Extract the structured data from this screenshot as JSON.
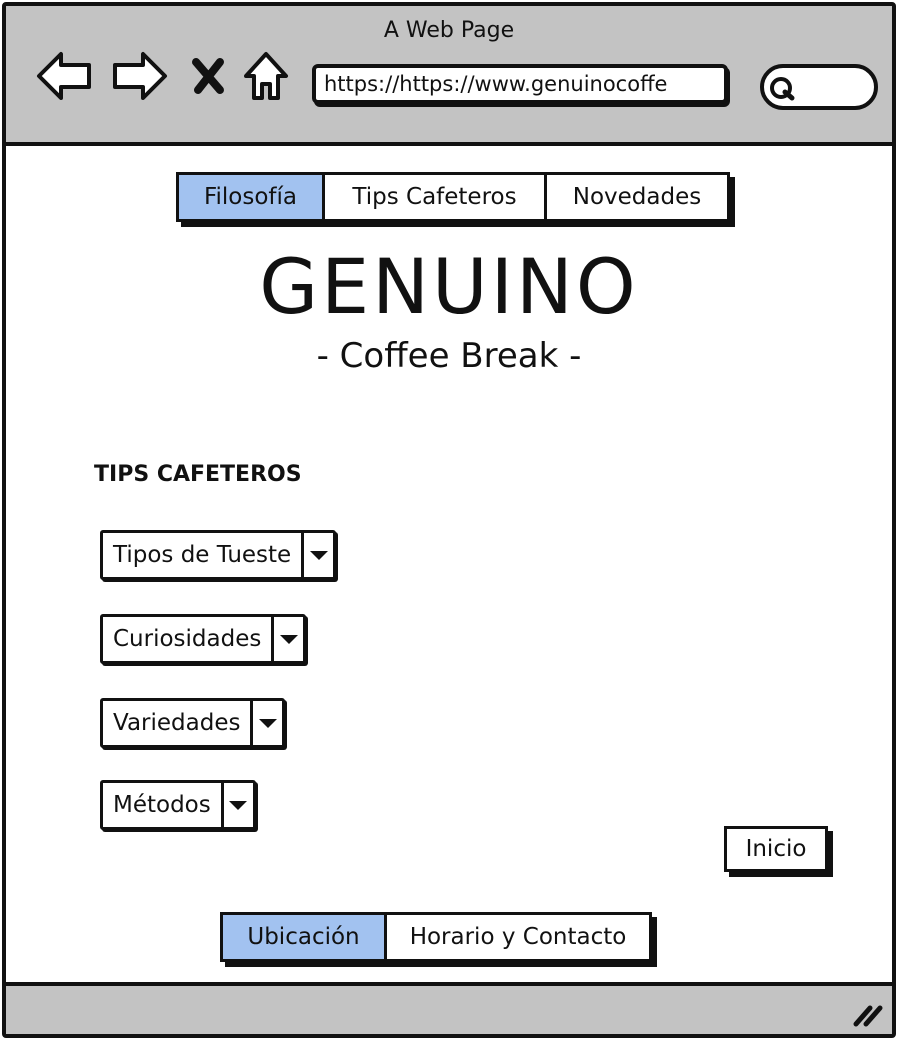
{
  "window": {
    "title": "A Web Page"
  },
  "browser": {
    "url": "https://https://www.genuinocoffe",
    "icons": [
      "back-arrow-icon",
      "forward-arrow-icon",
      "close-icon",
      "home-icon",
      "search-icon",
      "resize-grip-icon"
    ]
  },
  "top_nav": {
    "tabs": [
      {
        "label": "Filosofía",
        "active": true
      },
      {
        "label": "Tips Cafeteros",
        "active": false
      },
      {
        "label": "Novedades",
        "active": false
      }
    ]
  },
  "hero": {
    "brand": "GENUINO",
    "tagline": "- Coffee Break -"
  },
  "tips": {
    "heading": "TIPS CAFETEROS",
    "dropdowns": [
      {
        "label": "Tipos de Tueste"
      },
      {
        "label": "Curiosidades"
      },
      {
        "label": "Variedades"
      },
      {
        "label": "Métodos"
      }
    ]
  },
  "inicio_button": {
    "label": "Inicio"
  },
  "bottom_nav": {
    "tabs": [
      {
        "label": "Ubicación",
        "active": true
      },
      {
        "label": "Horario y Contacto",
        "active": false
      }
    ]
  },
  "colors": {
    "chrome": "#c3c3c3",
    "active_tab": "#a2c2f0",
    "ink": "#111111"
  }
}
